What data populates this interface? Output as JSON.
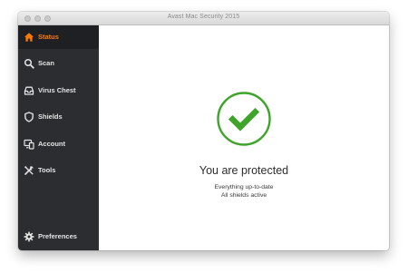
{
  "window": {
    "title": "Avast Mac Security 2015"
  },
  "sidebar": {
    "items": [
      {
        "label": "Status",
        "icon": "home-icon",
        "active": true
      },
      {
        "label": "Scan",
        "icon": "search-icon",
        "active": false
      },
      {
        "label": "Virus Chest",
        "icon": "inbox-icon",
        "active": false
      },
      {
        "label": "Shields",
        "icon": "shield-icon",
        "active": false
      },
      {
        "label": "Account",
        "icon": "monitor-icon",
        "active": false
      },
      {
        "label": "Tools",
        "icon": "tools-icon",
        "active": false
      }
    ],
    "footer": {
      "label": "Preferences",
      "icon": "gear-icon"
    }
  },
  "main": {
    "status_title": "You are protected",
    "status_lines": [
      "Everything up-to-date",
      "All shields active"
    ]
  },
  "colors": {
    "accent": "#ff7a00",
    "success": "#3ea52a",
    "sidebar_bg": "#2c2d31",
    "sidebar_active_bg": "#1f2023"
  }
}
